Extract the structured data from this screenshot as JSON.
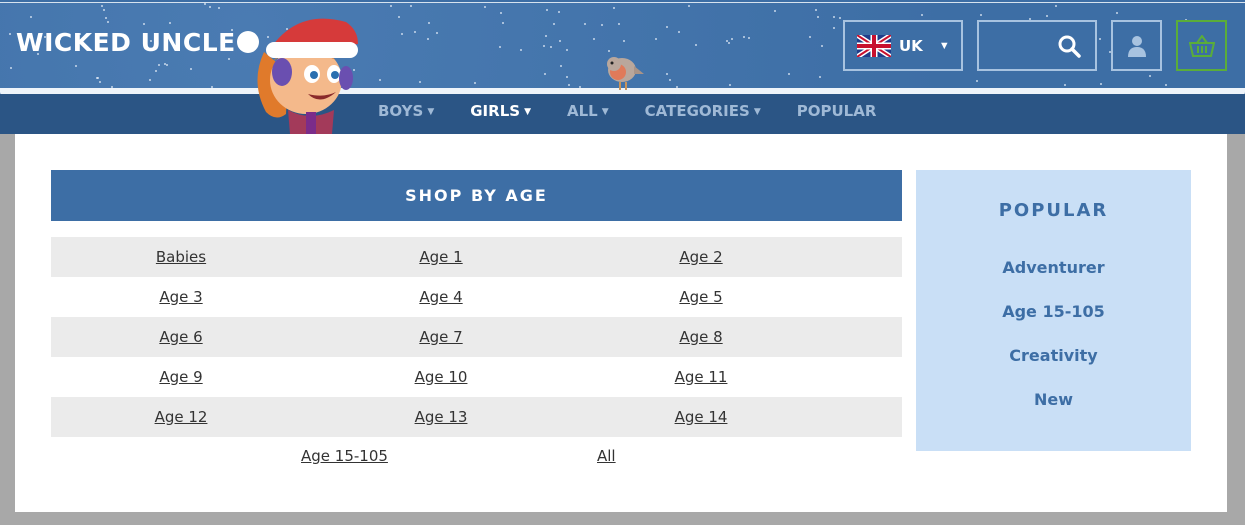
{
  "brand": {
    "logo_text": "WICKED UNCLE"
  },
  "header": {
    "country": "UK",
    "colors": {
      "header_blue": "#3d6ea5",
      "nav_dark": "#2b5585",
      "basket_green": "#5aad3a"
    },
    "icons": [
      "uk-flag-icon",
      "search-icon",
      "user-icon",
      "basket-icon"
    ]
  },
  "nav": {
    "items": [
      {
        "label": "BOYS",
        "has_dropdown": true,
        "active": false
      },
      {
        "label": "GIRLS",
        "has_dropdown": true,
        "active": true
      },
      {
        "label": "ALL",
        "has_dropdown": true,
        "active": false
      },
      {
        "label": "CATEGORIES",
        "has_dropdown": true,
        "active": false
      },
      {
        "label": "POPULAR",
        "has_dropdown": false,
        "active": false
      }
    ]
  },
  "shop_by_age": {
    "title": "SHOP BY AGE",
    "rows": [
      [
        "Babies",
        "Age 1",
        "Age 2"
      ],
      [
        "Age 3",
        "Age 4",
        "Age 5"
      ],
      [
        "Age 6",
        "Age 7",
        "Age 8"
      ],
      [
        "Age 9",
        "Age 10",
        "Age 11"
      ],
      [
        "Age 12",
        "Age 13",
        "Age 14"
      ]
    ],
    "last_row": [
      "Age 15-105",
      "All"
    ]
  },
  "popular": {
    "title": "POPULAR",
    "links": [
      "Adventurer",
      "Age 15-105",
      "Creativity",
      "New"
    ]
  }
}
